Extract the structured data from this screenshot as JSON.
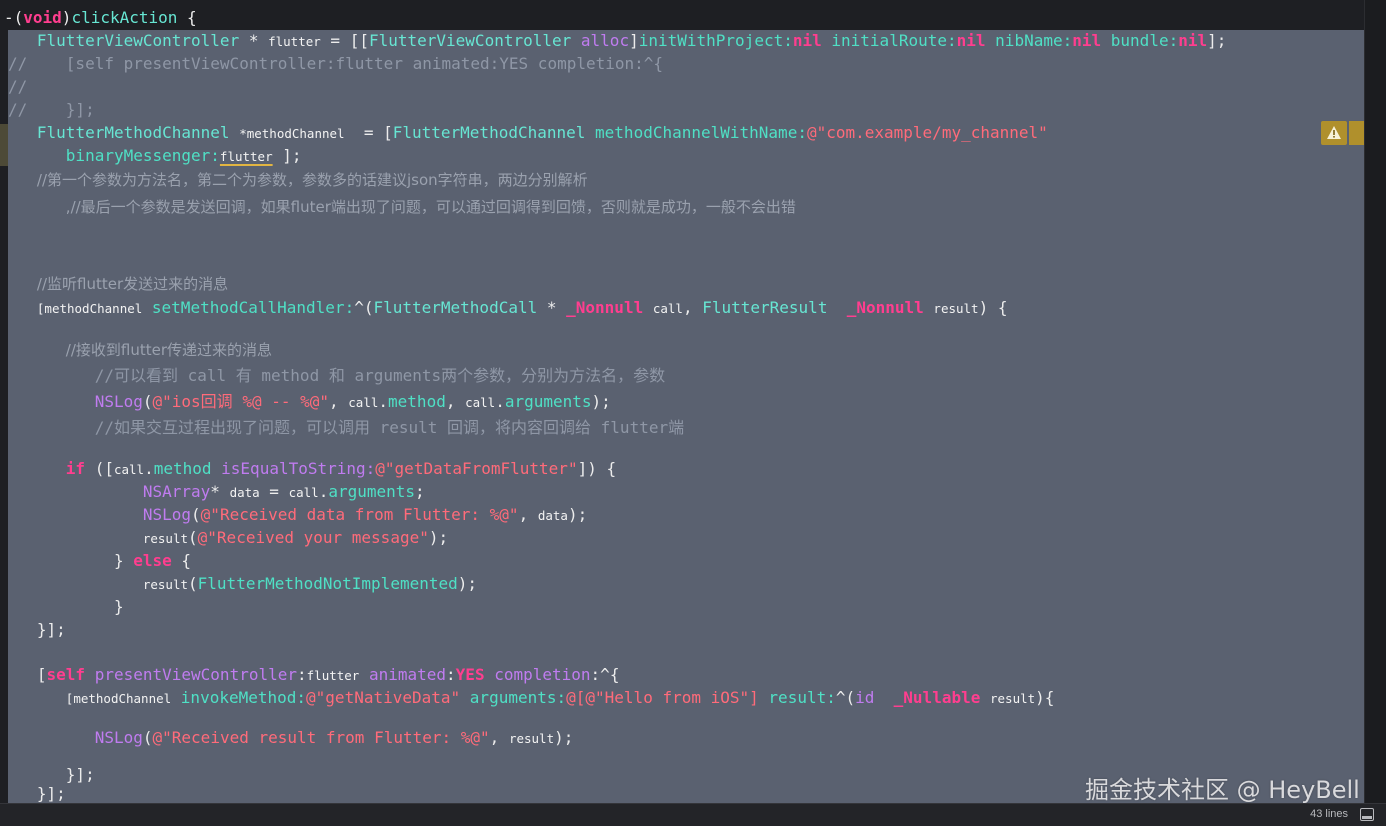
{
  "code_lines": [
    [
      [
        "pl",
        "-("
      ],
      [
        "kw",
        "void"
      ],
      [
        "pl",
        ")"
      ],
      [
        "fn",
        "clickAction"
      ],
      [
        "pl",
        " {"
      ]
    ],
    [
      [
        "pl",
        "   "
      ],
      [
        "ty",
        "FlutterViewController"
      ],
      [
        "pl",
        " * "
      ],
      [
        "sm",
        "flutter"
      ],
      [
        "pl",
        " = [["
      ],
      [
        "ty",
        "FlutterViewController"
      ],
      [
        "pl",
        " "
      ],
      [
        "pu",
        "alloc"
      ],
      [
        "pl",
        "]"
      ],
      [
        "mt",
        "initWithProject:"
      ],
      [
        "kw",
        "nil"
      ],
      [
        "pl",
        " "
      ],
      [
        "mt",
        "initialRoute:"
      ],
      [
        "kw",
        "nil"
      ],
      [
        "pl",
        " "
      ],
      [
        "mt",
        "nibName:"
      ],
      [
        "kw",
        "nil"
      ],
      [
        "pl",
        " "
      ],
      [
        "mt",
        "bundle:"
      ],
      [
        "kw",
        "nil"
      ],
      [
        "pl",
        "];"
      ]
    ],
    [
      [
        "cm",
        "//    [self presentViewController:flutter animated:YES completion:^{"
      ]
    ],
    [
      [
        "cm",
        "//"
      ]
    ],
    [
      [
        "cm",
        "//    }];"
      ]
    ],
    [
      [
        "pl",
        "   "
      ],
      [
        "ty",
        "FlutterMethodChannel"
      ],
      [
        "pl",
        " "
      ],
      [
        "sm",
        "*methodChannel"
      ],
      [
        "pl",
        "  = ["
      ],
      [
        "ty",
        "FlutterMethodChannel"
      ],
      [
        "pl",
        " "
      ],
      [
        "mt",
        "methodChannelWithName:"
      ],
      [
        "st",
        "@\"com.example/my_channel\""
      ]
    ],
    [
      [
        "pl",
        "      "
      ],
      [
        "mt",
        "binaryMessenger:"
      ],
      [
        "ul",
        "flutter"
      ],
      [
        "pl",
        " ];"
      ]
    ],
    [
      [
        "pl",
        "   "
      ],
      [
        "cmc",
        "//第一个参数为方法名，第二个为参数，参数多的话建议json字符串，两边分别解析"
      ]
    ],
    [
      [
        "pl",
        "      "
      ],
      [
        "cmc",
        ",//最后一个参数是发送回调，如果fluter端出现了问题，可以通过回调得到回馈，否则就是成功，一般不会出错"
      ]
    ],
    [
      [
        "pl",
        "   "
      ],
      [
        "cmc",
        "//监听flutter发送过来的消息"
      ]
    ],
    [
      [
        "pl",
        "   "
      ],
      [
        "sm",
        "[methodChannel"
      ],
      [
        "pl",
        " "
      ],
      [
        "mt",
        "setMethodCallHandler:"
      ],
      [
        "pl",
        "^("
      ],
      [
        "ty",
        "FlutterMethodCall"
      ],
      [
        "pl",
        " * "
      ],
      [
        "kw",
        "_Nonnull"
      ],
      [
        "pl",
        " "
      ],
      [
        "sm",
        "call"
      ],
      [
        "pl",
        ", "
      ],
      [
        "ty",
        "FlutterResult"
      ],
      [
        "pl",
        "  "
      ],
      [
        "kw",
        "_Nonnull"
      ],
      [
        "pl",
        " "
      ],
      [
        "sm",
        "result"
      ],
      [
        "pl",
        ") {"
      ]
    ],
    [
      [
        "pl",
        "      "
      ],
      [
        "cmc",
        "//接收到flutter传递过来的消息"
      ]
    ],
    [
      [
        "pl",
        "         "
      ],
      [
        "cm",
        "//可以看到 call 有 method 和 arguments两个参数，分别为方法名，参数"
      ]
    ],
    [
      [
        "pl",
        "         "
      ],
      [
        "pu",
        "NSLog"
      ],
      [
        "pl",
        "("
      ],
      [
        "st",
        "@\"ios回调 %@ -- %@\""
      ],
      [
        "pl",
        ", "
      ],
      [
        "sm",
        "call"
      ],
      [
        "pl",
        "."
      ],
      [
        "mt",
        "method"
      ],
      [
        "pl",
        ", "
      ],
      [
        "sm",
        "call"
      ],
      [
        "pl",
        "."
      ],
      [
        "mt",
        "arguments"
      ],
      [
        "pl",
        ");"
      ]
    ],
    [
      [
        "pl",
        "         "
      ],
      [
        "cm",
        "//如果交互过程出现了问题，可以调用 result 回调，将内容回调给 flutter端"
      ]
    ],
    [
      [
        "pl",
        "      "
      ],
      [
        "kw",
        "if"
      ],
      [
        "pl",
        " (["
      ],
      [
        "sm",
        "call"
      ],
      [
        "pl",
        "."
      ],
      [
        "mt",
        "method"
      ],
      [
        "pl",
        " "
      ],
      [
        "pu",
        "isEqualToString:"
      ],
      [
        "st",
        "@\"getDataFromFlutter\""
      ],
      [
        "pl",
        "]) {"
      ]
    ],
    [
      [
        "pl",
        "              "
      ],
      [
        "pu",
        "NSArray"
      ],
      [
        "pl",
        "* "
      ],
      [
        "sm",
        "data"
      ],
      [
        "pl",
        " = "
      ],
      [
        "sm",
        "call"
      ],
      [
        "pl",
        "."
      ],
      [
        "mt",
        "arguments"
      ],
      [
        "pl",
        ";"
      ]
    ],
    [
      [
        "pl",
        "              "
      ],
      [
        "pu",
        "NSLog"
      ],
      [
        "pl",
        "("
      ],
      [
        "st",
        "@\"Received data from Flutter: %@\""
      ],
      [
        "pl",
        ", "
      ],
      [
        "sm",
        "data"
      ],
      [
        "pl",
        ");"
      ]
    ],
    [
      [
        "pl",
        "              "
      ],
      [
        "sm",
        "result"
      ],
      [
        "pl",
        "("
      ],
      [
        "st",
        "@\"Received your message\""
      ],
      [
        "pl",
        ");"
      ]
    ],
    [
      [
        "pl",
        "           } "
      ],
      [
        "kw",
        "else"
      ],
      [
        "pl",
        " {"
      ]
    ],
    [
      [
        "pl",
        "              "
      ],
      [
        "sm",
        "result"
      ],
      [
        "pl",
        "("
      ],
      [
        "mt",
        "FlutterMethodNotImplemented"
      ],
      [
        "pl",
        ");"
      ]
    ],
    [
      [
        "pl",
        "           }"
      ]
    ],
    [
      [
        "pl",
        "   }];"
      ]
    ],
    [
      [
        "pl",
        "   ["
      ],
      [
        "kw",
        "self"
      ],
      [
        "pl",
        " "
      ],
      [
        "pu",
        "presentViewController"
      ],
      [
        "pl",
        ":"
      ],
      [
        "sm",
        "flutter"
      ],
      [
        "pl",
        " "
      ],
      [
        "pu",
        "animated"
      ],
      [
        "pl",
        ":"
      ],
      [
        "kw",
        "YES"
      ],
      [
        "pl",
        " "
      ],
      [
        "pu",
        "completion"
      ],
      [
        "pl",
        ":^{"
      ]
    ],
    [
      [
        "pl",
        "      "
      ],
      [
        "sm",
        "[methodChannel"
      ],
      [
        "pl",
        " "
      ],
      [
        "mt",
        "invokeMethod:"
      ],
      [
        "st",
        "@\"getNativeData\""
      ],
      [
        "pl",
        " "
      ],
      [
        "mt",
        "arguments:"
      ],
      [
        "st",
        "@[@\"Hello from iOS\"]"
      ],
      [
        "pl",
        " "
      ],
      [
        "mt",
        "result:"
      ],
      [
        "pl",
        "^("
      ],
      [
        "pu",
        "id"
      ],
      [
        "pl",
        "  "
      ],
      [
        "kw",
        "_Nullable"
      ],
      [
        "pl",
        " "
      ],
      [
        "sm",
        "result"
      ],
      [
        "pl",
        "){"
      ]
    ],
    [
      [
        "pl",
        "         "
      ],
      [
        "pu",
        "NSLog"
      ],
      [
        "pl",
        "("
      ],
      [
        "st",
        "@\"Received result from Flutter: %@\""
      ],
      [
        "pl",
        ", "
      ],
      [
        "sm",
        "result"
      ],
      [
        "pl",
        ");"
      ]
    ],
    [
      [
        "pl",
        "      }];"
      ]
    ],
    [
      [
        "pl",
        "   }];"
      ]
    ]
  ],
  "colors": {
    "background": "#1e1f23",
    "highlight": "#5a6170",
    "keyword": "#ff3e8f",
    "type": "#67e6d3",
    "string": "#ff6b7a",
    "comment": "#8f97a6",
    "purple": "#c07cf0",
    "warning": "#b0902c"
  },
  "warning_icon": "warning-triangle-icon",
  "status": {
    "lines_count": "43 lines"
  },
  "watermark": "掘金技术社区 @ HeyBell"
}
